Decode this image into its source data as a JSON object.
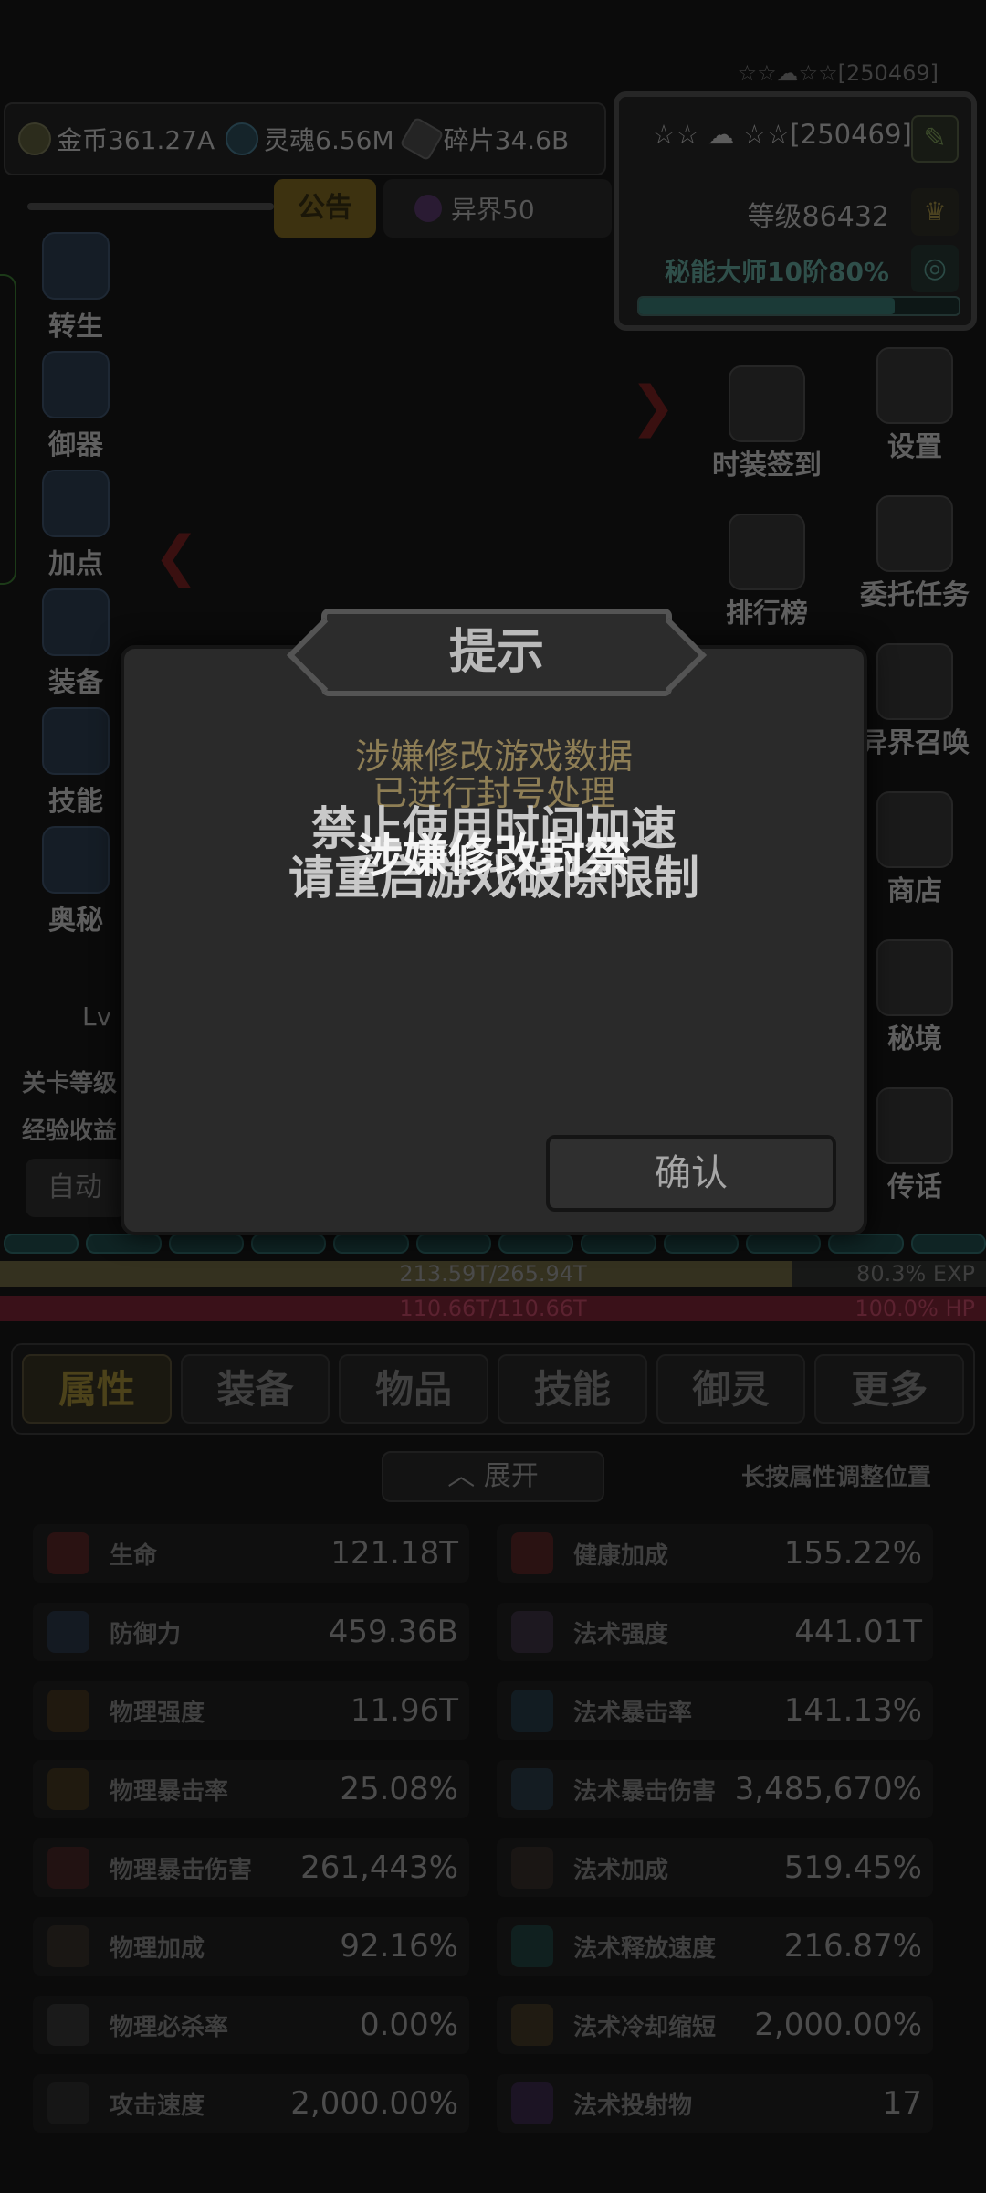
{
  "header": {
    "player_tag": "☆☆☁☆☆[250469]",
    "currencies": [
      {
        "icon": "gold-coin-icon",
        "label": "金币361.27A"
      },
      {
        "icon": "soul-icon",
        "label": "灵魂6.56M"
      },
      {
        "icon": "shard-icon",
        "label": "碎片34.6B"
      }
    ],
    "notice": "公告",
    "realm": "异界50"
  },
  "profile": {
    "id": "☆☆ ☁ ☆☆[250469]",
    "level": "等级86432",
    "class": "秘能大师10阶80%",
    "class_progress": 0.8
  },
  "left_menu": [
    "转生",
    "御器",
    "加点",
    "装备",
    "技能",
    "奥秘"
  ],
  "right_menu": [
    "时装签到",
    "排行榜",
    "异界召唤",
    "商店",
    "秘境",
    "传话"
  ],
  "right_menu_far": [
    "设置",
    "委托任务"
  ],
  "lv_label": "Lv",
  "stage": {
    "level_label": "关卡等级",
    "exp_label": "经验收益",
    "auto_label": "自动"
  },
  "bars": {
    "exp": {
      "text": "213.59T/265.94T",
      "right": "80.3% EXP",
      "fraction": 0.803
    },
    "hp": {
      "text": "110.66T/110.66T",
      "right": "100.0% HP",
      "fraction": 1.0
    }
  },
  "tabs": [
    "属性",
    "装备",
    "物品",
    "技能",
    "御灵",
    "更多"
  ],
  "expand": "展开",
  "hint": "长按属性调整位置",
  "stats": [
    {
      "name": "生命",
      "value": "121.18T",
      "icon": "heart-icon"
    },
    {
      "name": "健康加成",
      "value": "155.22%",
      "icon": "heart-plus-icon"
    },
    {
      "name": "防御力",
      "value": "459.36B",
      "icon": "shield-icon"
    },
    {
      "name": "法术强度",
      "value": "441.01T",
      "icon": "magic-power-icon"
    },
    {
      "name": "物理强度",
      "value": "11.96T",
      "icon": "sword-icon"
    },
    {
      "name": "法术暴击率",
      "value": "141.13%",
      "icon": "magic-crit-icon"
    },
    {
      "name": "物理暴击率",
      "value": "25.08%",
      "icon": "crit-icon"
    },
    {
      "name": "法术暴击伤害",
      "value": "3,485,670%",
      "icon": "magic-crit-damage-icon"
    },
    {
      "name": "物理暴击伤害",
      "value": "261,443%",
      "icon": "crit-damage-icon"
    },
    {
      "name": "法术加成",
      "value": "519.45%",
      "icon": "magic-bonus-icon"
    },
    {
      "name": "物理加成",
      "value": "92.16%",
      "icon": "physical-bonus-icon"
    },
    {
      "name": "法术释放速度",
      "value": "216.87%",
      "icon": "cast-speed-icon"
    },
    {
      "name": "物理必杀率",
      "value": "0.00%",
      "icon": "skull-icon"
    },
    {
      "name": "法术冷却缩短",
      "value": "2,000.00%",
      "icon": "hourglass-icon"
    },
    {
      "name": "攻击速度",
      "value": "2,000.00%",
      "icon": "attack-speed-icon"
    },
    {
      "name": "法术投射物",
      "value": "17",
      "icon": "projectile-icon"
    }
  ],
  "dialog": {
    "title": "提示",
    "message_line1": "涉嫌修改游戏数据",
    "message_line2": "已进行封号处理",
    "confirm": "确认"
  },
  "toast": {
    "line1": "禁止使用时间加速",
    "line2": "请重启游戏破除限制",
    "overlay": "涉嫌修改封禁"
  }
}
